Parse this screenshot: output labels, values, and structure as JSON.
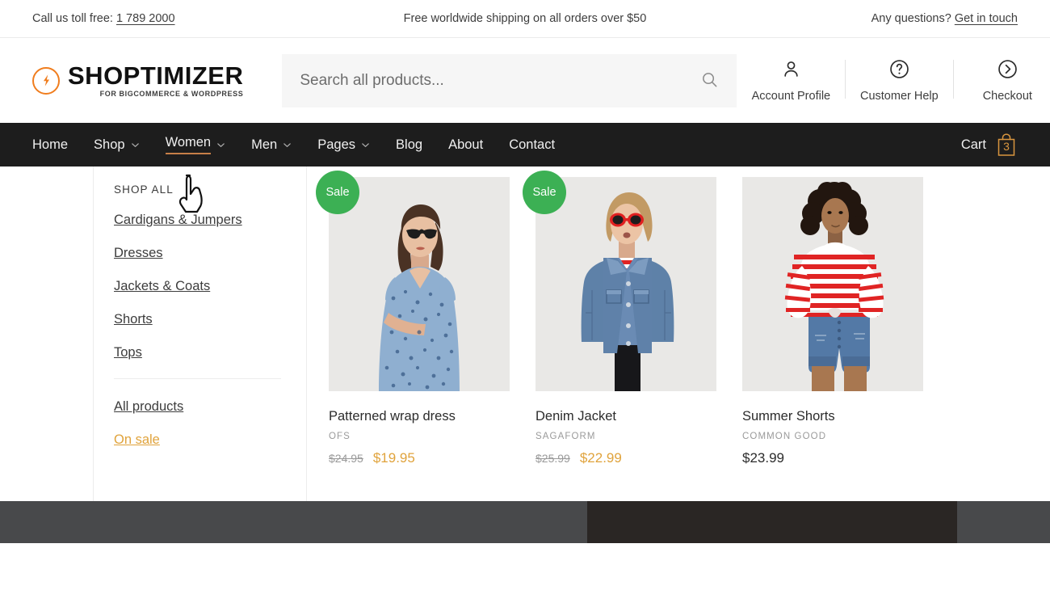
{
  "topbar": {
    "phone_prefix": "Call us toll free:",
    "phone": "1 789 2000",
    "shipping_notice": "Free worldwide shipping on all orders over $50",
    "questions_prefix": "Any questions?",
    "contact_link": "Get in touch"
  },
  "brand": {
    "name": "SHOPTIMIZER",
    "tagline": "FOR BIGCOMMERCE & WORDPRESS",
    "logo_icon": "lightning-bolt-circle-icon",
    "accent_color": "#f07d1e"
  },
  "search": {
    "placeholder": "Search all products...",
    "value": "",
    "icon": "search-icon"
  },
  "header_actions": [
    {
      "label": "Account Profile",
      "icon": "user-icon"
    },
    {
      "label": "Customer Help",
      "icon": "question-circle-icon"
    },
    {
      "label": "Checkout",
      "icon": "chevron-right-circle-icon"
    }
  ],
  "nav": {
    "items": [
      {
        "label": "Home",
        "has_dropdown": false,
        "active": false
      },
      {
        "label": "Shop",
        "has_dropdown": true,
        "active": false
      },
      {
        "label": "Women",
        "has_dropdown": true,
        "active": true
      },
      {
        "label": "Men",
        "has_dropdown": true,
        "active": false
      },
      {
        "label": "Pages",
        "has_dropdown": true,
        "active": false
      },
      {
        "label": "Blog",
        "has_dropdown": false,
        "active": false
      },
      {
        "label": "About",
        "has_dropdown": false,
        "active": false
      },
      {
        "label": "Contact",
        "has_dropdown": false,
        "active": false
      }
    ],
    "cart": {
      "label": "Cart",
      "count": "3",
      "icon": "shopping-bag-icon",
      "color": "#d9963f"
    },
    "background_color": "#1d1d1d",
    "active_underline_color": "#c77f48"
  },
  "megamenu": {
    "heading": "SHOP ALL",
    "categories": [
      {
        "label": "Cardigans & Jumpers"
      },
      {
        "label": "Dresses"
      },
      {
        "label": "Jackets & Coats"
      },
      {
        "label": "Shorts"
      },
      {
        "label": "Tops"
      }
    ],
    "secondary_links": [
      {
        "label": "All products",
        "highlight": false
      },
      {
        "label": "On sale",
        "highlight": true
      }
    ],
    "highlight_color": "#e0a33c",
    "products": [
      {
        "title": "Patterned wrap dress",
        "brand": "OFS",
        "price_old": "$24.95",
        "price_new": "$19.95",
        "badge": "Sale",
        "on_sale": true,
        "image_alt": "woman in blue patterned wrap dress wearing sunglasses"
      },
      {
        "title": "Denim Jacket",
        "brand": "SAGAFORM",
        "price_old": "$25.99",
        "price_new": "$22.99",
        "badge": "Sale",
        "on_sale": true,
        "image_alt": "woman in blue denim jacket with red sunglasses and striped top"
      },
      {
        "title": "Summer Shorts",
        "brand": "COMMON GOOD",
        "price_old": "",
        "price_new": "$23.99",
        "badge": "",
        "on_sale": false,
        "image_alt": "woman in red striped long sleeve top and denim shorts"
      }
    ],
    "badge_color": "#3cb054"
  },
  "cursor": {
    "type": "pointing-hand-cursor"
  }
}
